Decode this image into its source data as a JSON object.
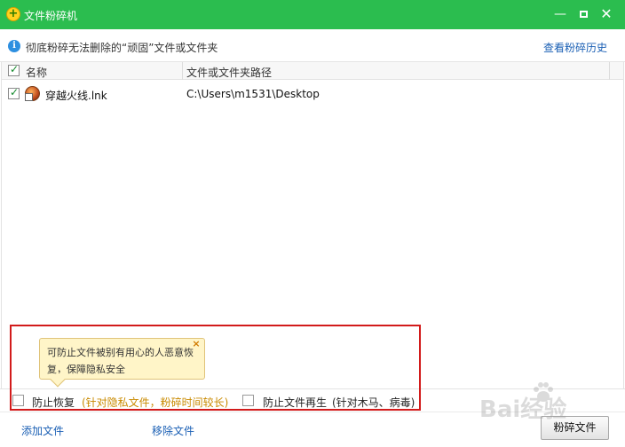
{
  "window": {
    "title": "文件粉碎机",
    "controls": {
      "minimize": "—",
      "maximize": "",
      "close": "✕"
    }
  },
  "info": {
    "text": "彻底粉碎无法删除的“顽固”文件或文件夹",
    "history_link": "查看粉碎历史"
  },
  "table": {
    "columns": {
      "name": "名称",
      "path": "文件或文件夹路径"
    },
    "rows": [
      {
        "checked": true,
        "name": "穿越火线.lnk",
        "path": "C:\\Users\\m1531\\Desktop"
      }
    ]
  },
  "tooltip": {
    "text": "可防止文件被别有用心的人恶意恢复，保障隐私安全",
    "close": "×"
  },
  "options": {
    "prevent_recovery": {
      "label": "防止恢复",
      "note": "(针对隐私文件，粉碎时间较长)",
      "checked": false
    },
    "prevent_regen": {
      "label": "防止文件再生",
      "note": "(针对木马、病毒)",
      "checked": false
    }
  },
  "footer": {
    "add_file": "添加文件",
    "remove_file": "移除文件",
    "shred_button": "粉碎文件"
  },
  "watermark": {
    "text": "Bai经验"
  },
  "colors": {
    "titlebar": "#2bbd4f",
    "link": "#1a5fb4",
    "note_orange": "#c98a00",
    "highlight_red": "#d21b1b",
    "tooltip_bg": "#fff5c8"
  },
  "icons": {
    "app_logo": "shield-plus-icon",
    "info": "info-icon",
    "file": "game-shortcut-icon"
  }
}
